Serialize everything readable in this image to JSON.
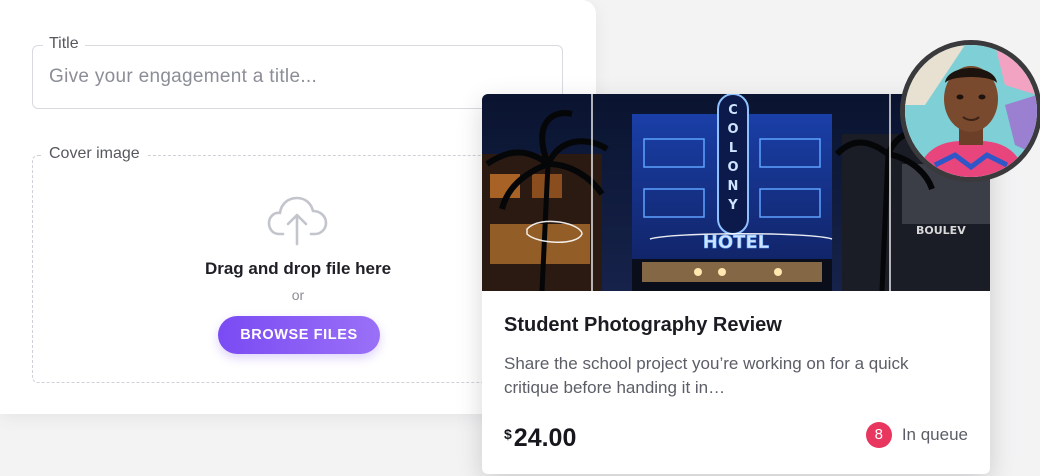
{
  "form": {
    "title_field": {
      "legend": "Title",
      "placeholder": "Give your engagement a title..."
    },
    "cover_field": {
      "legend": "Cover image",
      "icon": "cloud-upload-icon",
      "drag_text": "Drag and drop file here",
      "or_text": "or",
      "browse_label": "BROWSE FILES"
    }
  },
  "listing": {
    "image": "neon-hotel-photo",
    "sign_text": "COLONY",
    "hotel_text": "HOTEL",
    "title": "Student Photography Review",
    "description": "Share the school project you’re working on for a quick critique before handing it in…",
    "price_currency": "$",
    "price_amount": "24.00",
    "queue_count": "8",
    "queue_label": "In queue"
  },
  "colors": {
    "accent": "#7a4bf3",
    "badge": "#e8365e",
    "neon": "#3b8bff"
  },
  "avatar": "user-avatar"
}
